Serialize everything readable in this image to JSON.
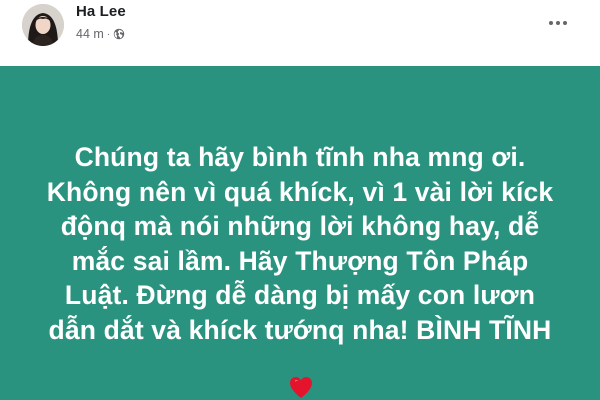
{
  "post": {
    "author": "Ha Lee",
    "timestamp": "44 m",
    "separator": "·",
    "audience_icon": "globe-icon",
    "more_icon": "more-options-icon",
    "background_color": "#2a937f",
    "text_lines": [
      "Chúng ta hãy bình tĩnh nha mng ơi.",
      "Không nên vì quá khíck, vì 1 vài lời kíck",
      "độnq mà nói những lời không hay, dễ",
      "mắc sai lầm. Hãy Thượng Tôn Pháp",
      "Luật. Đừng dễ dàng bị mấy con lươn",
      "dẫn dắt và khíck tướnq nha! BÌNH TĨNH"
    ],
    "emoji": "heart-icon"
  }
}
